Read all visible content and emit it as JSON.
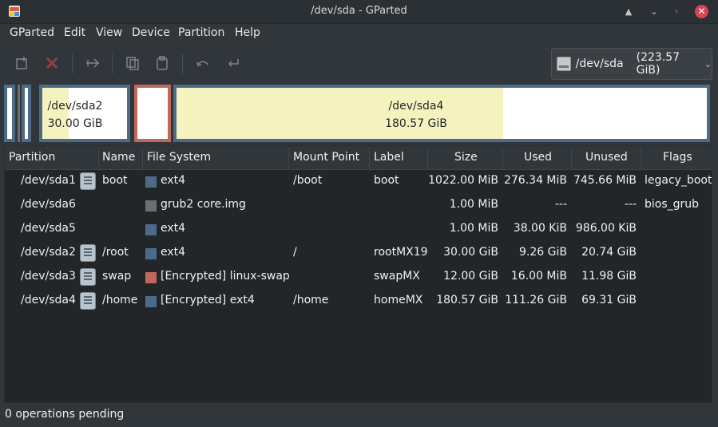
{
  "window": {
    "title": "/dev/sda - GParted",
    "minimize": "▲",
    "maximize": "⌄",
    "restore": "◦",
    "close": "✕"
  },
  "menu": [
    "GParted",
    "Edit",
    "View",
    "Device",
    "Partition",
    "Help"
  ],
  "toolbar": {
    "icons": [
      "new-icon",
      "delete-icon",
      "resize-icon",
      "copy-icon",
      "paste-icon",
      "undo-icon",
      "apply-icon"
    ]
  },
  "device": {
    "name": "/dev/sda",
    "size": "(223.57 GiB)"
  },
  "diskmap": {
    "sda2": {
      "name": "/dev/sda2",
      "size": "30.00 GiB",
      "used_fraction": 0.31
    },
    "sda4": {
      "name": "/dev/sda4",
      "size": "180.57 GiB",
      "used_fraction": 0.616
    }
  },
  "columns": [
    "Partition",
    "Name",
    "File System",
    "Mount Point",
    "Label",
    "Size",
    "Used",
    "Unused",
    "Flags"
  ],
  "rows": [
    {
      "partition": "/dev/sda1",
      "locked": true,
      "name": "boot",
      "fs": "ext4",
      "fs_color": "#4c6b88",
      "mount": "/boot",
      "label": "boot",
      "size": "1022.00 MiB",
      "used": "276.34 MiB",
      "unused": "745.66 MiB",
      "flags": "legacy_boot"
    },
    {
      "partition": "/dev/sda6",
      "locked": false,
      "name": "",
      "fs": "grub2 core.img",
      "fs_color": "#6e6e6e",
      "mount": "",
      "label": "",
      "size": "1.00 MiB",
      "used": "---",
      "unused": "---",
      "flags": "bios_grub"
    },
    {
      "partition": "/dev/sda5",
      "locked": false,
      "name": "",
      "fs": "ext4",
      "fs_color": "#4c6b88",
      "mount": "",
      "label": "",
      "size": "1.00 MiB",
      "used": "38.00 KiB",
      "unused": "986.00 KiB",
      "flags": ""
    },
    {
      "partition": "/dev/sda2",
      "locked": true,
      "name": "/root",
      "fs": "ext4",
      "fs_color": "#4c6b88",
      "mount": "/",
      "label": "rootMX19",
      "size": "30.00 GiB",
      "used": "9.26 GiB",
      "unused": "20.74 GiB",
      "flags": ""
    },
    {
      "partition": "/dev/sda3",
      "locked": true,
      "name": "swap",
      "fs": "[Encrypted] linux-swap",
      "fs_color": "#c0675a",
      "mount": "",
      "label": "swapMX",
      "size": "12.00 GiB",
      "used": "16.00 MiB",
      "unused": "11.98 GiB",
      "flags": ""
    },
    {
      "partition": "/dev/sda4",
      "locked": true,
      "name": "/home",
      "fs": "[Encrypted] ext4",
      "fs_color": "#4c6b88",
      "mount": "/home",
      "label": "homeMX",
      "size": "180.57 GiB",
      "used": "111.26 GiB",
      "unused": "69.31 GiB",
      "flags": ""
    }
  ],
  "status": "0 operations pending"
}
